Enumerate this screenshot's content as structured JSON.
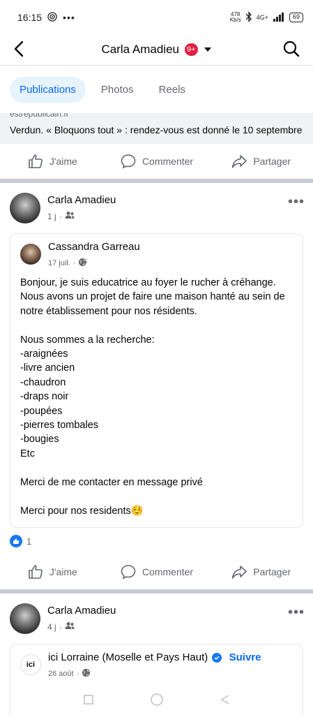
{
  "status_bar": {
    "time": "16:15",
    "net_speed_value": "478",
    "net_speed_unit": "Kb/s",
    "network": "4G+",
    "battery": "69"
  },
  "header": {
    "title": "Carla Amadieu",
    "badge": "9+"
  },
  "tabs": [
    {
      "label": "Publications",
      "active": true
    },
    {
      "label": "Photos",
      "active": false
    },
    {
      "label": "Reels",
      "active": false
    }
  ],
  "top_post": {
    "link_domain": "estrepublicain.fr",
    "link_title": "Verdun. « Bloquons tout » : rendez-vous est donné le 10 septembre"
  },
  "actions": {
    "like": "J'aime",
    "comment": "Commenter",
    "share": "Partager"
  },
  "post1": {
    "author": "Carla Amadieu",
    "time": "1 j",
    "shared": {
      "author": "Cassandra Garreau",
      "date": "17 juil.",
      "text": "Bonjour, je suis educatrice au foyer le rucher à créhange. Nous avons un projet de faire une maison hanté au sein de notre établissement pour nos résidents.\n\nNous sommes a la recherche:\n-araignées\n-livre ancien\n-chaudron\n-draps noir\n-poupées\n-pierres tombales\n-bougies\nEtc\n\nMerci de me contacter en message privé\n\nMerci pour nos residents☺️"
    },
    "reaction_count": "1"
  },
  "post2": {
    "author": "Carla Amadieu",
    "time": "4 j",
    "shared": {
      "logo_text": "ici",
      "author": "ici Lorraine (Moselle et Pays Haut)",
      "follow": "Suivre",
      "date": "26 août"
    }
  },
  "colors": {
    "accent": "#0866ff",
    "badge": "#e41e3f",
    "muted": "#65676b",
    "separator": "#c9ccd1"
  }
}
